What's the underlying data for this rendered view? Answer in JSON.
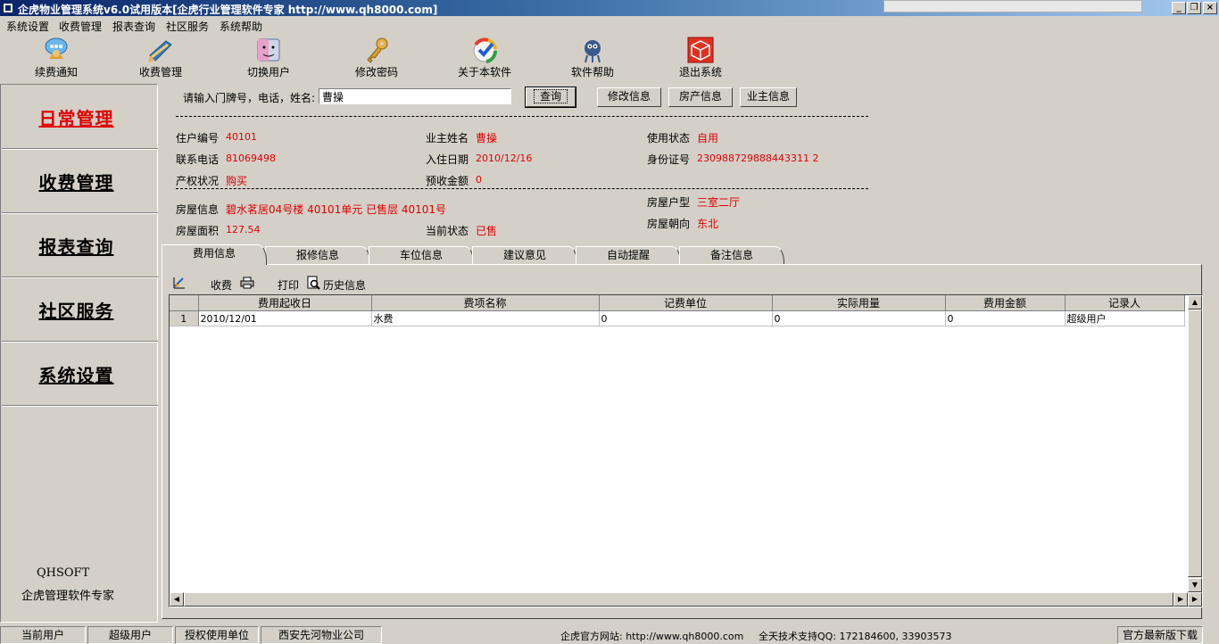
{
  "window": {
    "title": "企虎物业管理系统v6.0试用版本[企虎行业管理软件专家 http://www.qh8000.com]",
    "controls": {
      "minimize": "_",
      "restore": "❐",
      "close": "×"
    }
  },
  "menu": [
    "系统设置",
    "收费管理",
    "报表查询",
    "社区服务",
    "系统帮助"
  ],
  "toolbar": [
    {
      "label": "续费通知",
      "icon": "notice-icon"
    },
    {
      "label": "收费管理",
      "icon": "pen-icon"
    },
    {
      "label": "切换用户",
      "icon": "finder-icon"
    },
    {
      "label": "修改密码",
      "icon": "key-icon"
    },
    {
      "label": "关于本软件",
      "icon": "check-icon"
    },
    {
      "label": "软件帮助",
      "icon": "help-icon"
    },
    {
      "label": "退出系统",
      "icon": "cube-icon"
    }
  ],
  "nav": {
    "items": [
      "日常管理",
      "收费管理",
      "报表查询",
      "社区服务",
      "系统设置"
    ],
    "active": "日常管理",
    "brand_en": "QHSOFT",
    "brand_cn": "企虎管理软件专家"
  },
  "search": {
    "label": "请输入门牌号，电话，姓名:",
    "value": "曹操",
    "query_button": "查询",
    "edit_button": "修改信息",
    "property_button": "房产信息",
    "owner_button": "业主信息"
  },
  "resident": {
    "id_label": "住户编号",
    "id": "40101",
    "owner_label": "业主姓名",
    "owner": "曹操",
    "usage_label": "使用状态",
    "usage": "自用",
    "phone_label": "联系电话",
    "phone": "81069498",
    "checkin_label": "入住日期",
    "checkin": "2010/12/16",
    "idcard_label": "身份证号",
    "idcard": "230988729888443311 2",
    "ownership_label": "产权状况",
    "ownership": "购买",
    "prepay_label": "预收金额",
    "prepay": "0",
    "house_label": "房屋信息",
    "house": "碧水茗居04号楼 40101单元 已售层 40101号",
    "type_label": "房屋户型",
    "type": "三室二厅",
    "area_label": "房屋面积",
    "area": "127.54",
    "state_label": "当前状态",
    "state": "已售",
    "orient_label": "房屋朝向",
    "orient": "东北"
  },
  "tabs": [
    "费用信息",
    "报修信息",
    "车位信息",
    "建议意见",
    "自动提醒",
    "备注信息"
  ],
  "active_tab": "费用信息",
  "subtoolbar": {
    "charge": "收费",
    "print": "打印",
    "history": "历史信息"
  },
  "grid": {
    "columns": [
      "费用起收日",
      "费项名称",
      "记费单位",
      "实际用量",
      "费用金额",
      "记录人"
    ],
    "rows": [
      {
        "num": "1",
        "cells": [
          "2010/12/01",
          "水费",
          "0",
          "0",
          "0",
          "超级用户"
        ]
      }
    ]
  },
  "status": {
    "user_label": "当前用户",
    "user": "超级用户",
    "unit_label": "授权使用单位",
    "unit": "西安先河物业公司",
    "site": "企虎官方网站: http://www.qh8000.com",
    "support": "全天技术支持QQ: 172184600, 33903573",
    "download": "官方最新版下载"
  }
}
